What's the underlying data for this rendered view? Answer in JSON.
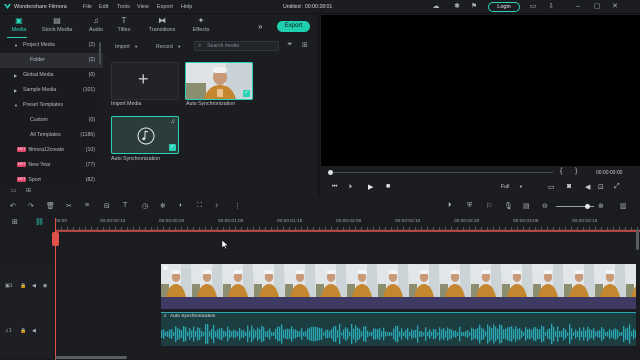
{
  "app": {
    "name": "Wondershare Filmora",
    "project_title": "Untitled : 00:00:28:01",
    "menu": [
      "File",
      "Edit",
      "Tools",
      "View",
      "Export",
      "Help"
    ],
    "login_label": "Login"
  },
  "toolbar": {
    "tabs": [
      {
        "label": "Media",
        "icon": "media-icon",
        "active": true
      },
      {
        "label": "Stock Media",
        "icon": "stock-media-icon",
        "active": false
      },
      {
        "label": "Audio",
        "icon": "audio-icon",
        "active": false
      },
      {
        "label": "Titles",
        "icon": "titles-icon",
        "active": false
      },
      {
        "label": "Transitions",
        "icon": "transitions-icon",
        "active": false
      },
      {
        "label": "Effects",
        "icon": "effects-icon",
        "active": false
      }
    ],
    "export_label": "Export"
  },
  "sidebar": {
    "items": [
      {
        "label": "Project Media",
        "count": "(2)"
      },
      {
        "label": "Folder",
        "count": "(2)"
      },
      {
        "label": "Global Media",
        "count": "(0)"
      },
      {
        "label": "Sample Media",
        "count": "(101)"
      },
      {
        "label": "Preset Templates",
        "count": ""
      },
      {
        "label": "Custom",
        "count": "(0)"
      },
      {
        "label": "All Templates",
        "count": "(1186)"
      },
      {
        "label": "filmora12create",
        "count": "(10)"
      },
      {
        "label": "New Year",
        "count": "(77)"
      },
      {
        "label": "Sport",
        "count": "(82)"
      }
    ]
  },
  "media": {
    "import_label": "Import",
    "record_label": "Record",
    "search_placeholder": "Search media",
    "items": [
      {
        "label": "Import Media"
      },
      {
        "label": "Auto Synchronization"
      },
      {
        "label": "Auto Synchronization"
      }
    ]
  },
  "preview": {
    "timecode": "00:00:00:00",
    "quality": "Full",
    "markers": [
      "{",
      "}"
    ]
  },
  "timeline": {
    "ruler": [
      "00:00",
      "00:00:00:10",
      "00:00:00:20",
      "00:00:01:05",
      "00:00:01:15",
      "00:00:02:00",
      "00:00:02:10",
      "00:00:02:20",
      "00:00:03:05",
      "00:00:03:15"
    ],
    "video_clip_label": "Auto Synchronization",
    "audio_clip_label": "Auto Synchronization",
    "track_video": "1",
    "track_audio": "1"
  },
  "colors": {
    "accent": "#1fcfae",
    "playhead": "#e0504a",
    "waveform": "#2aa7b3",
    "background": "#1c1d21"
  }
}
